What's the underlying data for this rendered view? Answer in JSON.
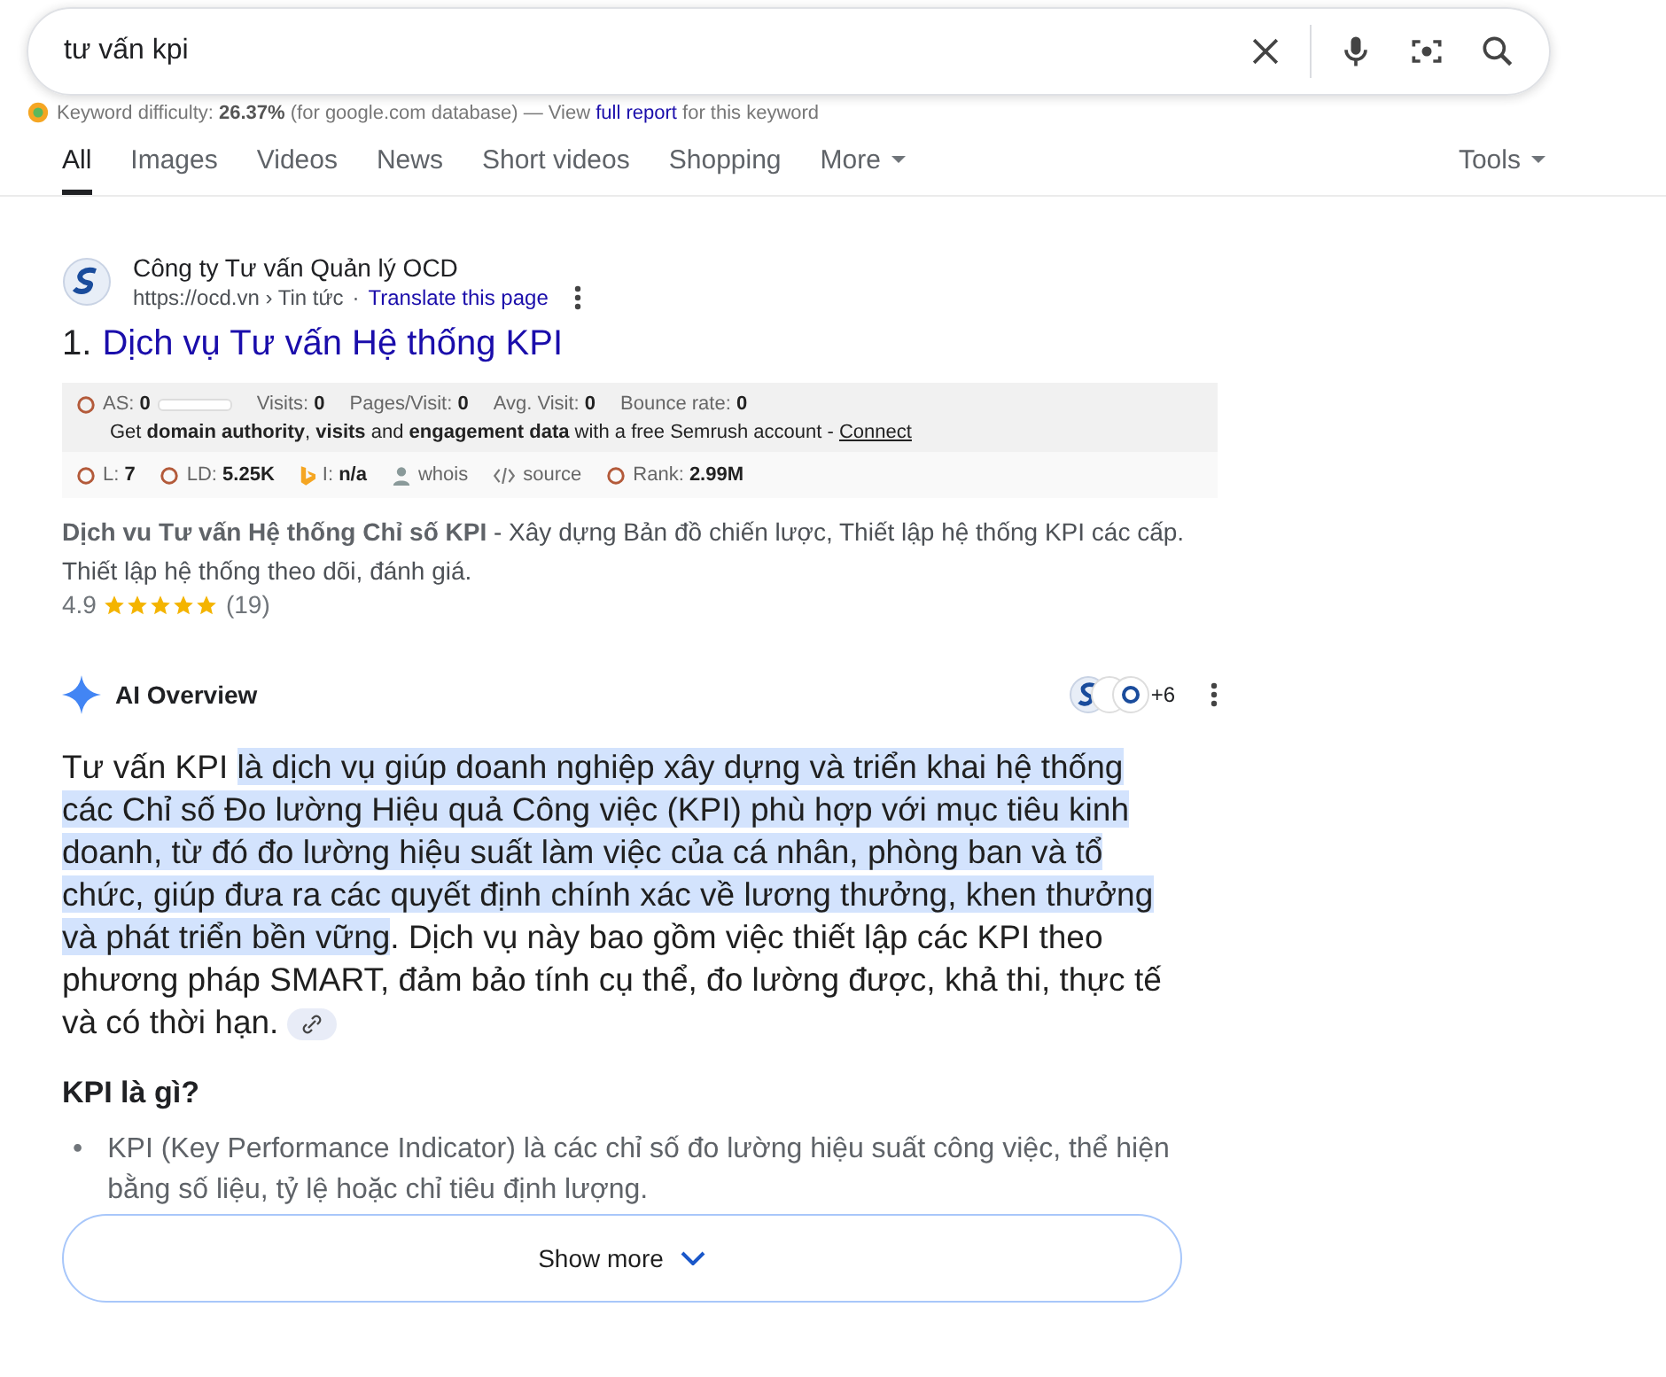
{
  "search": {
    "value": "tư vấn kpi"
  },
  "keyword_bar": {
    "label": "Keyword difficulty:",
    "value": "26.37%",
    "note": "(for google.com database) — View",
    "link": "full report",
    "tail": "for this keyword"
  },
  "tabs": [
    {
      "label": "All",
      "selected": true
    },
    {
      "label": "Images",
      "selected": false
    },
    {
      "label": "Videos",
      "selected": false
    },
    {
      "label": "News",
      "selected": false
    },
    {
      "label": "Short videos",
      "selected": false
    },
    {
      "label": "Shopping",
      "selected": false
    },
    {
      "label": "More",
      "selected": false,
      "dropdown": true
    }
  ],
  "tools": {
    "label": "Tools"
  },
  "result": {
    "site": "Công ty Tư vấn Quản lý OCD",
    "url": "https://ocd.vn › Tin tức",
    "separator": "·",
    "translate": "Translate this page",
    "number": "1.",
    "title": "Dịch vụ Tư vấn Hệ thống KPI",
    "seo_row_1": [
      {
        "label": "AS:",
        "value": "0",
        "kind": "bar",
        "level": 0
      },
      {
        "label": "Visits:",
        "value": "0",
        "kind": "plain"
      },
      {
        "label": "Pages/Visit:",
        "value": "0",
        "kind": "plain"
      },
      {
        "label": "Avg. Visit:",
        "value": "0",
        "kind": "plain"
      },
      {
        "label": "Bounce rate:",
        "value": "0",
        "kind": "plain"
      }
    ],
    "seo_promo": "Get **domain authority**, **visits** and **engagement data** with a free Semrush account -",
    "seo_link": "Connect",
    "seo_row_2": [
      {
        "label": "L:",
        "value": "7",
        "kind": "circle"
      },
      {
        "label": "LD:",
        "value": "5.25K",
        "kind": "circle"
      },
      {
        "label": "I:",
        "value": "n/a",
        "kind": "bing"
      },
      {
        "label": "whois",
        "kind": "person"
      },
      {
        "label": "source",
        "kind": "code"
      },
      {
        "label": "Rank:",
        "value": "2.99M",
        "kind": "circle"
      }
    ],
    "snippet": "**Dịch vu Tư vấn Hệ thống Chỉ số KPI** - Xây dựng Bản đồ chiến lược, Thiết lập hệ thống KPI các cấp. Thiết lập hệ thống theo dõi, đánh giá.",
    "rating": "4.9",
    "stars": 5,
    "reviews": "(19)"
  },
  "ai_overview": {
    "title": "AI Overview",
    "sources_more": "+6",
    "paragraph": [
      {
        "text": "Tư vấn KPI ",
        "highlighted": false
      },
      {
        "text": "là dịch vụ giúp doanh nghiệp xây dựng và triển khai hệ thống các Chỉ số Đo lường Hiệu quả Công việc (KPI) phù hợp với mục tiêu kinh doanh, từ đó đo lường hiệu suất làm việc của cá nhân, phòng ban và tổ chức, giúp đưa ra các quyết định chính xác về lương thưởng, khen thưởng và phát triển bền vững",
        "highlighted": true
      },
      {
        "text": ". Dịch vụ này bao gồm việc thiết lập các KPI theo phương pháp SMART, đảm bảo tính cụ thể, đo lường được, khả thi, thực tế và có thời hạn.",
        "highlighted": false
      }
    ],
    "heading": "KPI là gì?",
    "bullets": [
      {
        "marker": "•",
        "text": "KPI (Key Performance Indicator) là các chỉ số đo lường hiệu suất công việc, thể hiện bằng số liệu, tỷ lệ hoặc chỉ tiêu định lượng."
      }
    ],
    "show_more": "Show more"
  }
}
